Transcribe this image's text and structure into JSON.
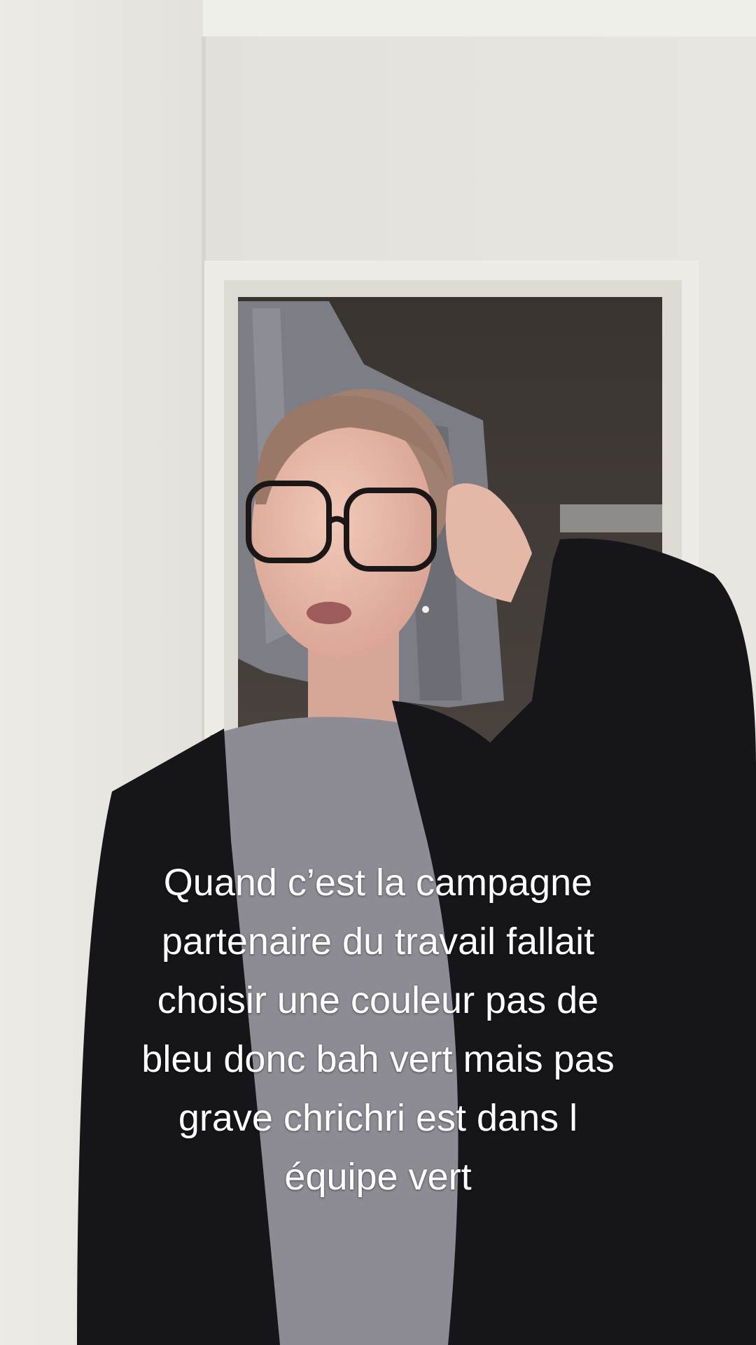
{
  "video": {
    "caption_lines": [
      "Quand c’est la campagne",
      "partenaire du travail fallait",
      "choisir une couleur pas de",
      "bleu donc bah vert mais pas",
      "grave chrichri est dans l",
      "équipe vert"
    ]
  },
  "colors": {
    "wall": "#e7e4df",
    "door_frame": "#eeeae5",
    "dark_room": "#3f3935",
    "curtain": "#7c7d85",
    "cardigan": "#15151a",
    "top": "#8d8c95",
    "skin": "#e4b7a6",
    "caption_text": "#ffffff"
  }
}
